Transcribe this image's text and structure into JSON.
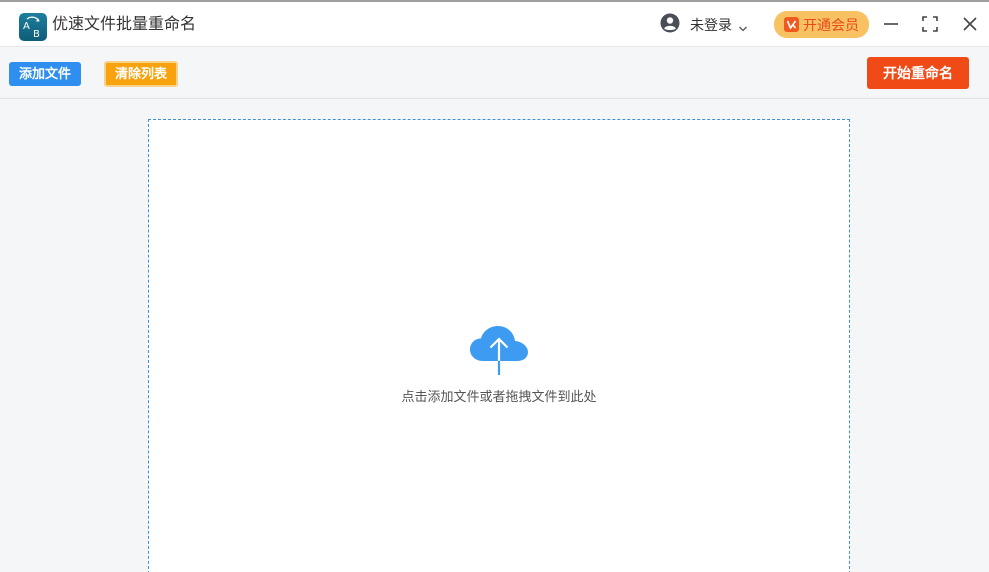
{
  "window": {
    "title": "优速文件批量重命名",
    "logo_icon": "ab-rename-logo-icon"
  },
  "account": {
    "login_label": "未登录",
    "user_icon": "user-avatar-icon",
    "dropdown_icon": "chevron-down-icon"
  },
  "vip": {
    "label": "开通会员",
    "icon": "vip-badge-icon"
  },
  "window_controls": {
    "minimize_icon": "minimize-icon",
    "maximize_icon": "maximize-icon",
    "close_icon": "close-icon"
  },
  "toolbar": {
    "add_files_label": "添加文件",
    "clear_list_label": "清除列表",
    "start_rename_label": "开始重命名"
  },
  "dropzone": {
    "hint": "点击添加文件或者拖拽文件到此处",
    "icon": "cloud-upload-icon"
  },
  "colors": {
    "primary_blue": "#2e8ff0",
    "clear_orange": "#f8a20e",
    "start_red": "#f04a17",
    "vip_gold": "#f8c162"
  }
}
